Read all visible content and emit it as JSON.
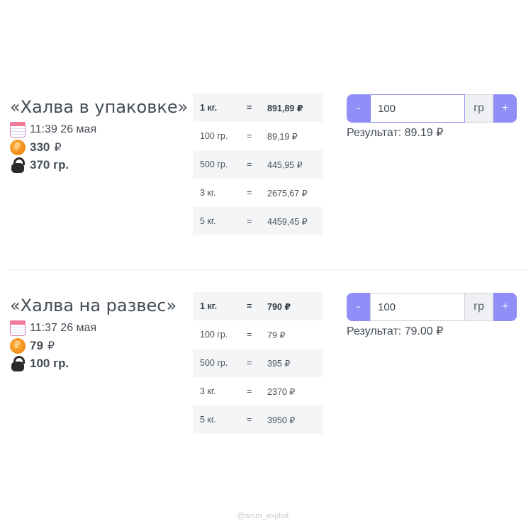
{
  "products": [
    {
      "title": "«Халва в упаковке»",
      "date": "11:39 26 мая",
      "price": "330",
      "currency": "₽",
      "weight": "370 гр.",
      "icons": {
        "date": "calendar-icon",
        "price": "coin-icon",
        "weight": "kettlebell-icon"
      },
      "table": [
        {
          "qty": "1 кг.",
          "eq": "=",
          "price": "891,89 ₽"
        },
        {
          "qty": "100 гр.",
          "eq": "=",
          "price": "89,19 ₽"
        },
        {
          "qty": "500 гр.",
          "eq": "=",
          "price": "445,95 ₽"
        },
        {
          "qty": "3 кг.",
          "eq": "=",
          "price": "2675,67 ₽"
        },
        {
          "qty": "5 кг.",
          "eq": "=",
          "price": "4459,45 ₽"
        }
      ],
      "calc": {
        "minus": "-",
        "value": "100",
        "unit": "гр",
        "plus": "+",
        "result": "Результат: 89.19 ₽"
      }
    },
    {
      "title": "«Халва на развес»",
      "date": "11:37 26 мая",
      "price": "79",
      "currency": "₽",
      "weight": "100 гр.",
      "icons": {
        "date": "calendar-icon",
        "price": "coin-icon",
        "weight": "kettlebell-icon"
      },
      "table": [
        {
          "qty": "1 кг.",
          "eq": "=",
          "price": "790 ₽"
        },
        {
          "qty": "100 гр.",
          "eq": "=",
          "price": "79 ₽"
        },
        {
          "qty": "500 гр.",
          "eq": "=",
          "price": "395 ₽"
        },
        {
          "qty": "3 кг.",
          "eq": "=",
          "price": "2370 ₽"
        },
        {
          "qty": "5 кг.",
          "eq": "=",
          "price": "3950 ₽"
        }
      ],
      "calc": {
        "minus": "-",
        "value": "100",
        "unit": "гр",
        "plus": "+",
        "result": "Результат: 79.00 ₽"
      }
    }
  ],
  "watermark": "@smm_exploit",
  "colors": {
    "accent": "#8f8ff7",
    "stripe": "#f4f5f7",
    "text": "#444c55"
  }
}
